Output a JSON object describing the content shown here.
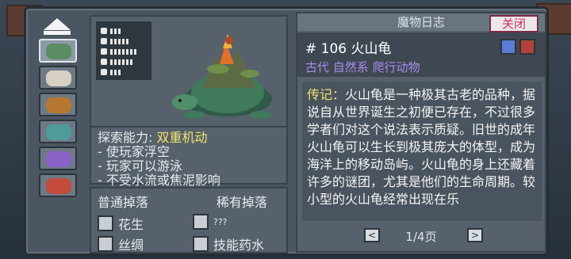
{
  "book": {
    "title": "魔物日志",
    "close_label": "关闭",
    "entry_number": "# 106 火山龟",
    "entry_tags": "古代 自然系 爬行动物",
    "lore_label": "传记：",
    "lore_text": "火山龟是一种极其古老的品种，据说自从世界诞生之初便已存在，不过很多学者们对这个说法表示质疑。旧世的成年火山龟可以生长到极其庞大的体型，成为海洋上的移动岛屿。火山龟的身上还藏着许多的谜团，尤其是他们的生命周期。较小型的火山龟经常出现在乐",
    "page": "1/4页",
    "prev_symbol": "<",
    "next_symbol": ">"
  },
  "abilities": {
    "label": "探索能力:",
    "name": "双重机动",
    "lines": [
      "- 使玩家浮空",
      "- 玩家可以游泳",
      "- 不受水流或焦泥影响"
    ]
  },
  "drops": {
    "common_label": "普通掉落",
    "rare_label": "稀有掉落",
    "common": [
      "花生",
      "丝绸"
    ],
    "rare": [
      "???",
      "技能药水"
    ]
  },
  "colors": {
    "panel": "#4b5662",
    "accent_yellow": "#f2e36a",
    "accent_purple": "#a88bf0",
    "close_text": "#c82e6e"
  }
}
